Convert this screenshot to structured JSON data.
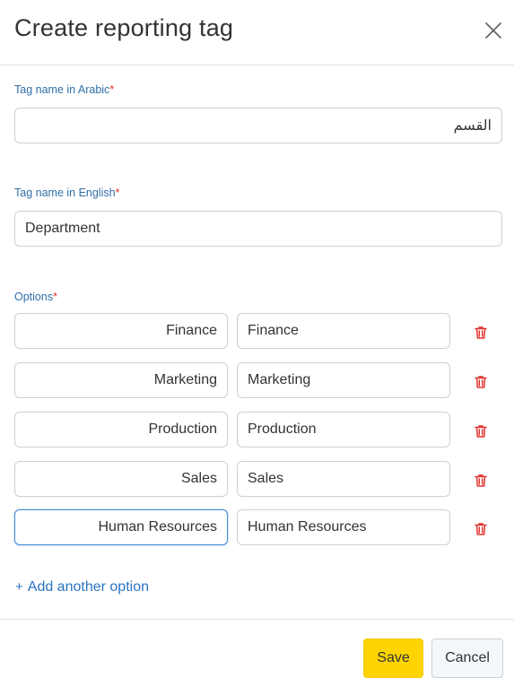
{
  "dialog": {
    "title": "Create reporting tag"
  },
  "fields": {
    "arabic_label": "Tag name in Arabic",
    "arabic_value": "القسم",
    "english_label": "Tag name in English",
    "english_value": "Department",
    "required_mark": "*"
  },
  "options": {
    "label": "Options",
    "items": [
      {
        "arabic": "Finance",
        "english": "Finance"
      },
      {
        "arabic": "Marketing",
        "english": "Marketing"
      },
      {
        "arabic": "Production",
        "english": "Production"
      },
      {
        "arabic": "Sales",
        "english": "Sales"
      },
      {
        "arabic": "Human Resources",
        "english": "Human Resources"
      }
    ],
    "add_label": "Add another option",
    "add_icon": "+"
  },
  "footer": {
    "save_label": "Save",
    "cancel_label": "Cancel"
  },
  "colors": {
    "accent_label": "#2f6fa8",
    "required": "#e0342f",
    "link": "#2b73c2",
    "save_bg": "#ffd400",
    "trash": "#e0342f",
    "focus_border": "#4a90d9"
  },
  "icons": {
    "close": "close-icon",
    "delete": "trash-icon",
    "add": "plus-icon"
  }
}
